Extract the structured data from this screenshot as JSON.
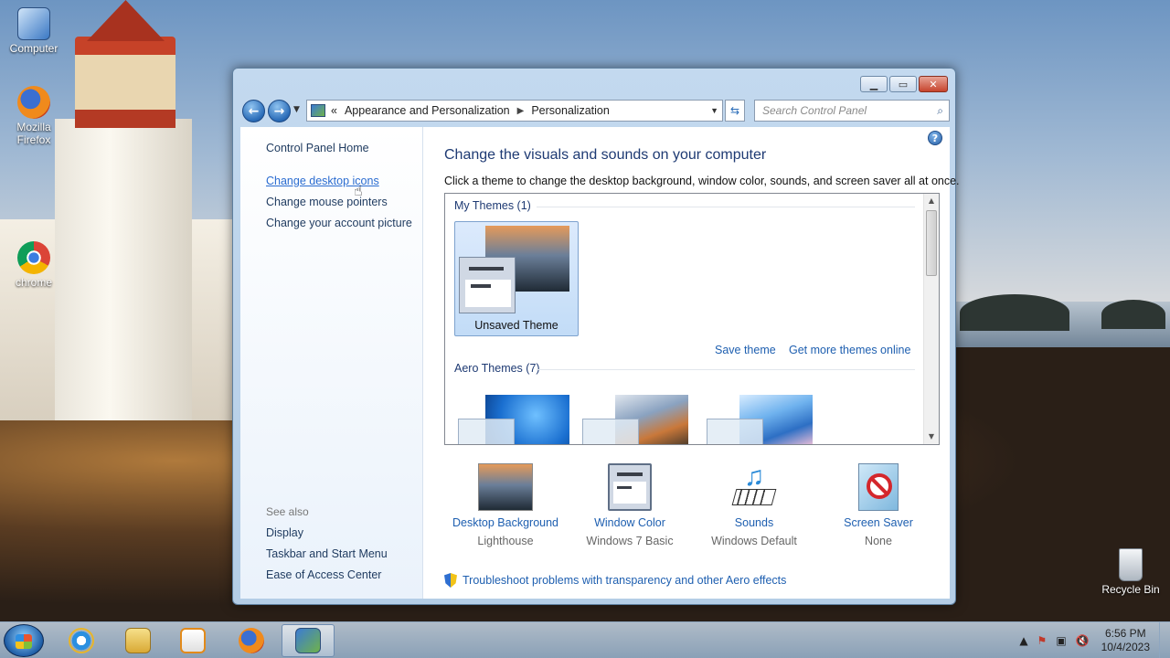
{
  "desktop": {
    "icons": [
      {
        "label": "Computer"
      },
      {
        "label": "Mozilla Firefox"
      },
      {
        "label": "chrome"
      },
      {
        "label": "Recycle Bin"
      }
    ]
  },
  "window": {
    "breadcrumb": [
      "Appearance and Personalization",
      "Personalization"
    ],
    "breadcrumb_prefix": "«",
    "search_placeholder": "Search Control Panel",
    "sidebar": {
      "home": "Control Panel Home",
      "links": [
        "Change desktop icons",
        "Change mouse pointers",
        "Change your account picture"
      ],
      "see_also_heading": "See also",
      "see_also": [
        "Display",
        "Taskbar and Start Menu",
        "Ease of Access Center"
      ]
    },
    "main": {
      "title": "Change the visuals and sounds on your computer",
      "subtitle": "Click a theme to change the desktop background, window color, sounds, and screen saver all at once.",
      "my_themes_label": "My Themes (1)",
      "current_theme": "Unsaved Theme",
      "save_theme": "Save theme",
      "more_themes": "Get more themes online",
      "aero_themes_label": "Aero Themes (7)",
      "settings": [
        {
          "name": "Desktop Background",
          "value": "Lighthouse"
        },
        {
          "name": "Window Color",
          "value": "Windows 7 Basic"
        },
        {
          "name": "Sounds",
          "value": "Windows Default"
        },
        {
          "name": "Screen Saver",
          "value": "None"
        }
      ],
      "troubleshoot": "Troubleshoot problems with transparency and other Aero effects"
    }
  },
  "taskbar": {
    "clock_time": "6:56 PM",
    "clock_date": "10/4/2023"
  }
}
